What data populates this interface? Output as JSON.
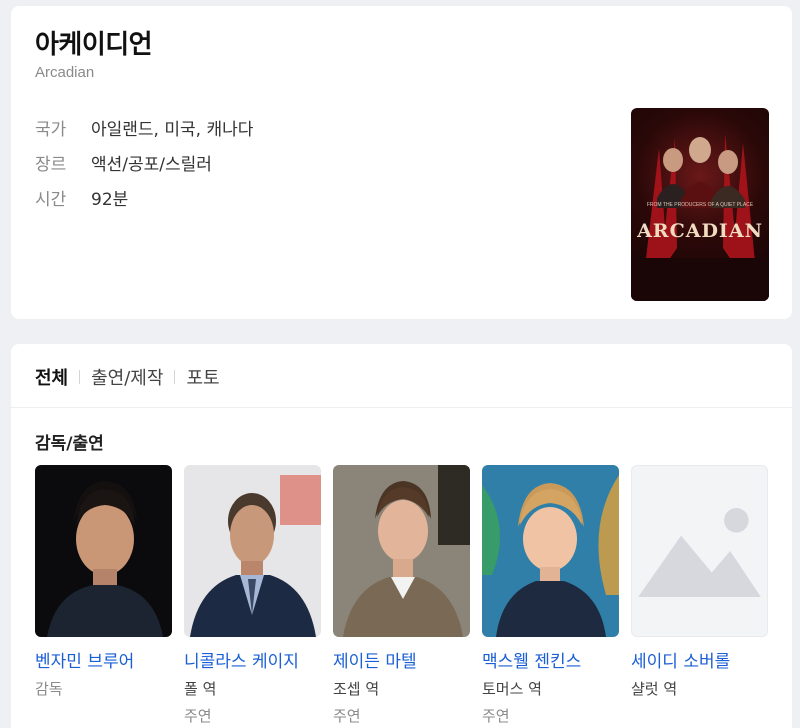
{
  "movie": {
    "title_ko": "아케이디언",
    "title_en": "Arcadian",
    "info": [
      {
        "key": "국가",
        "value": "아일랜드, 미국, 캐나다"
      },
      {
        "key": "장르",
        "value": "액션/공포/스릴러"
      },
      {
        "key": "시간",
        "value": "92분"
      }
    ],
    "poster": {
      "title": "ARCADIAN",
      "tagline": "FROM THE PRODUCERS OF A QUIET PLACE"
    }
  },
  "tabs": [
    {
      "label": "전체",
      "active": true
    },
    {
      "label": "출연/제작",
      "active": false
    },
    {
      "label": "포토",
      "active": false
    }
  ],
  "cast_section": {
    "title": "감독/출연",
    "people": [
      {
        "name": "벤자민 브루어",
        "role": "감독",
        "kind": ""
      },
      {
        "name": "니콜라스 케이지",
        "role": "폴 역",
        "kind": "주연"
      },
      {
        "name": "제이든 마텔",
        "role": "조셉 역",
        "kind": "주연"
      },
      {
        "name": "맥스웰 젠킨스",
        "role": "토머스 역",
        "kind": "주연"
      },
      {
        "name": "세이디 소버롤",
        "role": "샬럿 역",
        "kind": ""
      }
    ]
  },
  "colors": {
    "link": "#1a5fd6",
    "muted": "#8a8a8a",
    "background": "#eef0f4"
  }
}
